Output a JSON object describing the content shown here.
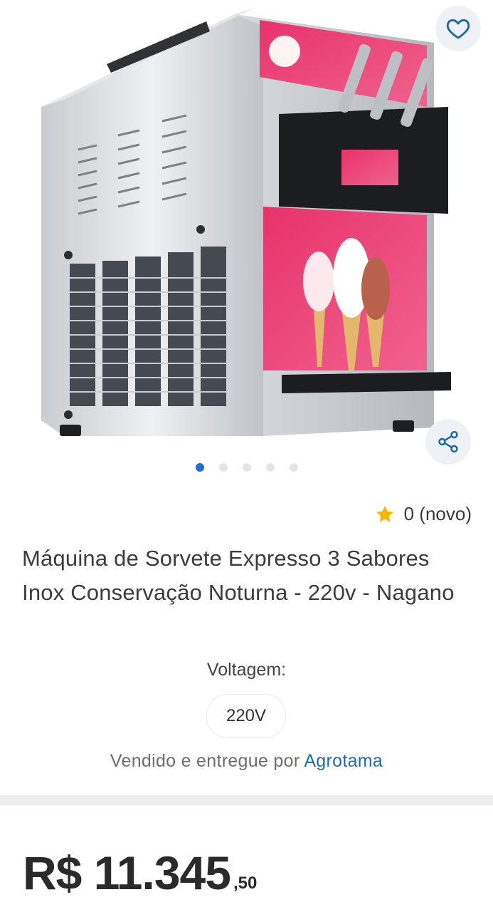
{
  "gallery": {
    "image_description": "soft-serve ice cream machine",
    "total_images": 5,
    "active_index": 0,
    "favorite_icon": "heart-outline-icon",
    "share_icon": "share-icon",
    "active_dot_color": "#1f6fd1"
  },
  "rating": {
    "icon": "star-icon",
    "text": "0 (novo)",
    "star_color": "#f5b800"
  },
  "product": {
    "title": "Máquina de Sorvete Expresso 3 Sabores Inox Conservação Noturna - 220v - Nagano"
  },
  "voltage": {
    "label": "Voltagem:",
    "selected": "220V"
  },
  "seller": {
    "prefix": "Vendido e entregue por",
    "name": "Agrotama",
    "link_color": "#1f6aa8"
  },
  "price": {
    "main": "R$ 11.345",
    "cents": ",50"
  }
}
